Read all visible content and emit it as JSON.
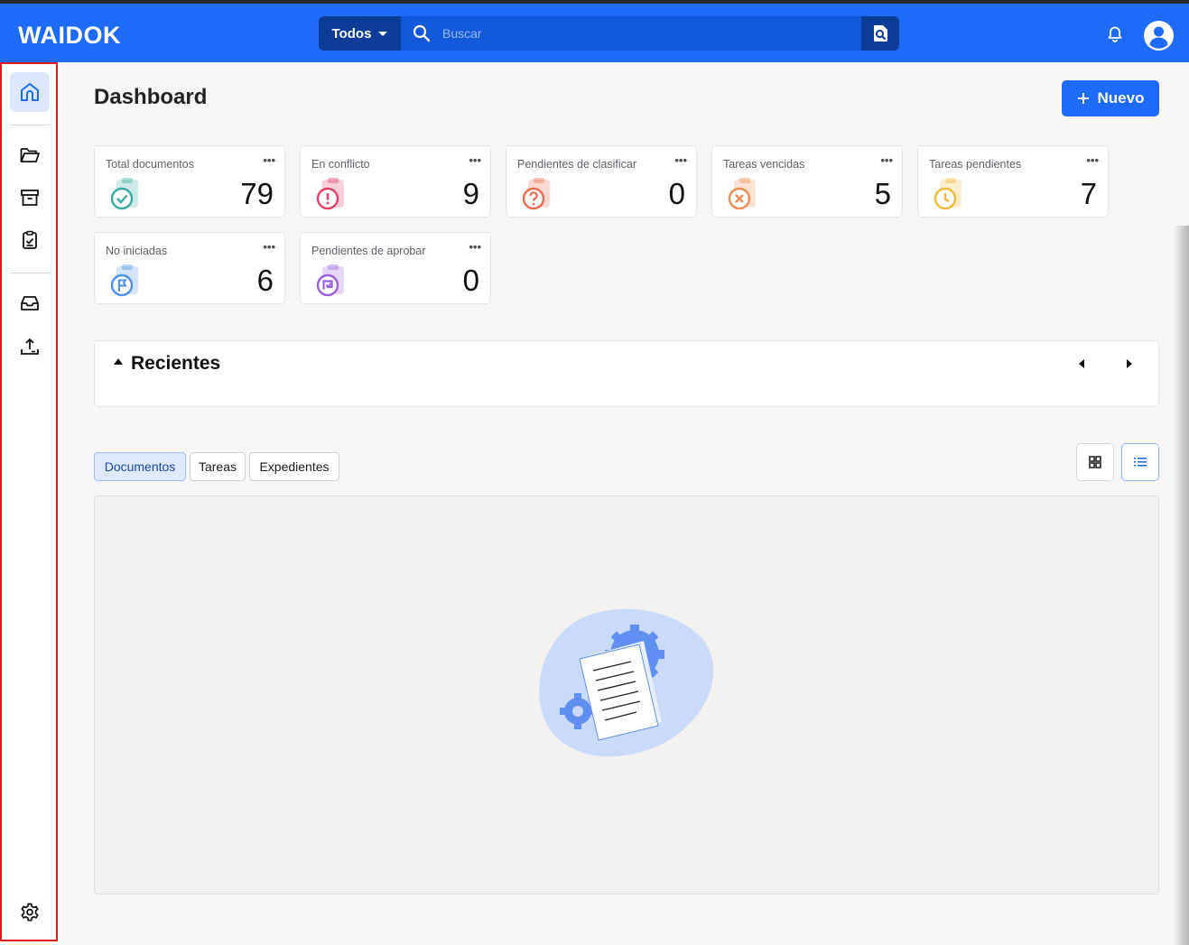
{
  "app": {
    "logo": "WAIDOK"
  },
  "header": {
    "scope_label": "Todos",
    "search_placeholder": "Buscar",
    "icons": [
      "search-icon",
      "advanced-search-icon",
      "bell-icon",
      "user-avatar-icon"
    ]
  },
  "sidebar": {
    "items": [
      {
        "icon": "home-icon",
        "active": true
      },
      {
        "icon": "folder-icon"
      },
      {
        "icon": "archive-icon"
      },
      {
        "icon": "clipboard-check-icon"
      },
      {
        "icon": "inbox-icon"
      },
      {
        "icon": "upload-icon"
      },
      {
        "icon": "settings-icon"
      }
    ]
  },
  "page": {
    "title": "Dashboard",
    "new_button": "Nuevo"
  },
  "stats": [
    {
      "label": "Total documentos",
      "value": "79",
      "more": "•••",
      "color": "#3aa9a0"
    },
    {
      "label": "En conflicto",
      "value": "9",
      "more": "•••",
      "color": "#e0416a"
    },
    {
      "label": "Pendientes de clasificar",
      "value": "0",
      "more": "•••",
      "color": "#e86a4f"
    },
    {
      "label": "Tareas vencidas",
      "value": "5",
      "more": "•••",
      "color": "#ef8a52"
    },
    {
      "label": "Tareas pendientes",
      "value": "7",
      "more": "•••",
      "color": "#f1b83a"
    },
    {
      "label": "No iniciadas",
      "value": "6",
      "more": "•••",
      "color": "#4f92e6"
    },
    {
      "label": "Pendientes de aprobar",
      "value": "0",
      "more": "•••",
      "color": "#9b5fe0"
    }
  ],
  "recent": {
    "title": "Recientes"
  },
  "tabs": [
    {
      "label": "Documentos",
      "active": true
    },
    {
      "label": "Tareas"
    },
    {
      "label": "Expedientes"
    }
  ],
  "view_toggle": {
    "options": [
      "grid-view-icon",
      "list-view-icon"
    ],
    "selected": "list-view-icon"
  },
  "colors": {
    "primary": "#1e6bf9",
    "header_dark": "#0c3c97",
    "sidebar_highlight": "#e0191f"
  }
}
